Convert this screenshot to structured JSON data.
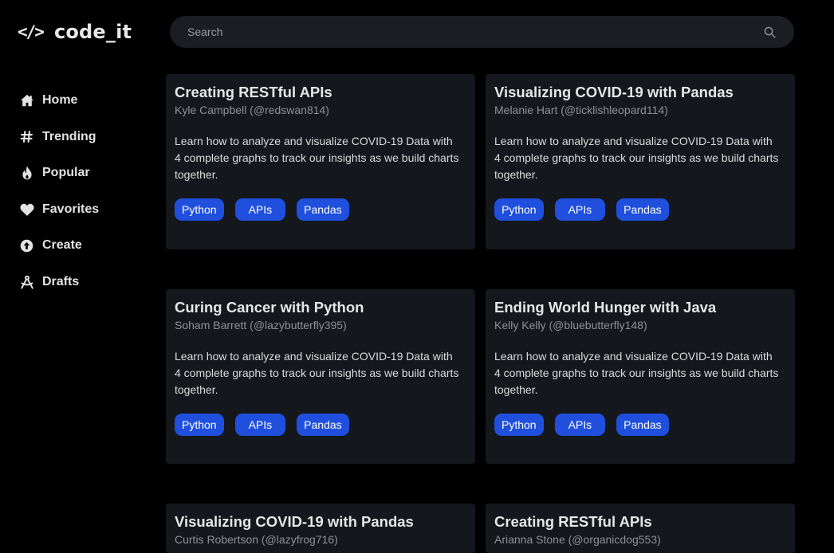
{
  "app": {
    "logo_icon": "</>",
    "logo_text": "code_it"
  },
  "search": {
    "placeholder": "Search",
    "icon": "search-icon"
  },
  "nav": {
    "items": [
      {
        "label": "Home",
        "icon": "home-icon"
      },
      {
        "label": "Trending",
        "icon": "hash-icon"
      },
      {
        "label": "Popular",
        "icon": "flame-icon"
      },
      {
        "label": "Favorites",
        "icon": "heart-icon"
      },
      {
        "label": "Create",
        "icon": "upload-icon"
      },
      {
        "label": "Drafts",
        "icon": "drafting-compass-icon"
      }
    ]
  },
  "posts": [
    {
      "title": "Creating RESTful APIs",
      "author": "Kyle Campbell (@redswan814)",
      "description": "Learn how to analyze and visualize COVID-19 Data with 4 complete graphs to track our insights as we build charts together.",
      "tags": [
        "Python",
        "APIs",
        "Pandas"
      ]
    },
    {
      "title": "Visualizing COVID-19 with Pandas",
      "author": "Melanie Hart (@ticklishleopard114)",
      "description": "Learn how to analyze and visualize COVID-19 Data with 4 complete graphs to track our insights as we build charts together.",
      "tags": [
        "Python",
        "APIs",
        "Pandas"
      ]
    },
    {
      "title": "Curing Cancer with Python",
      "author": "Soham Barrett (@lazybutterfly395)",
      "description": "Learn how to analyze and visualize COVID-19 Data with 4 complete graphs to track our insights as we build charts together.",
      "tags": [
        "Python",
        "APIs",
        "Pandas"
      ]
    },
    {
      "title": "Ending World Hunger with Java",
      "author": "Kelly Kelly (@bluebutterfly148)",
      "description": "Learn how to analyze and visualize COVID-19 Data with 4 complete graphs to track our insights as we build charts together.",
      "tags": [
        "Python",
        "APIs",
        "Pandas"
      ]
    },
    {
      "title": "Visualizing COVID-19 with Pandas",
      "author": "Curtis Robertson (@lazyfrog716)"
    },
    {
      "title": "Creating RESTful APIs",
      "author": "Arianna Stone (@organicdog553)"
    }
  ],
  "colors": {
    "background": "#000000",
    "card": "#14171c",
    "search": "#1a1d22",
    "tag": "#1f4fdc",
    "muted_text": "#8e9197"
  }
}
